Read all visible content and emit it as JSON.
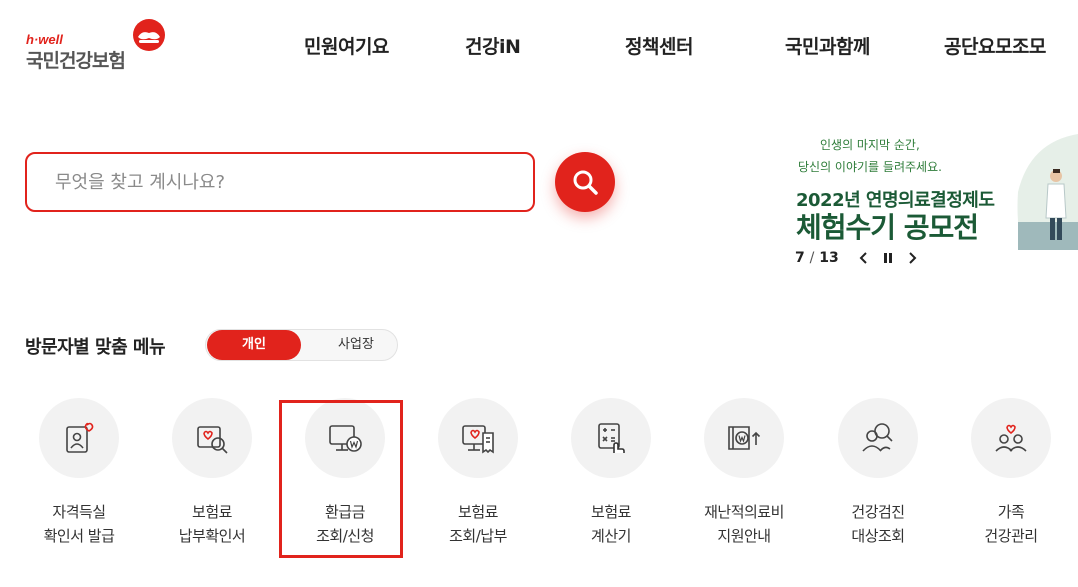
{
  "logo": {
    "tagline": "h·well",
    "name": "국민건강보험"
  },
  "nav": [
    "민원여기요",
    "건강iN",
    "정책센터",
    "국민과함께",
    "공단요모조모"
  ],
  "search": {
    "placeholder": "무엇을 찾고 계시나요?",
    "button_icon": "search-icon"
  },
  "banner": {
    "line1": "인생의 마지막 순간,",
    "line2": "당신의 이야기를 들려주세요.",
    "title1": "2022년 연명의료결정제도",
    "title2": "체험수기 공모전",
    "current": "7",
    "separator": "/",
    "total": "13"
  },
  "custom_menu": {
    "title": "방문자별 맞춤 메뉴",
    "toggle": [
      "개인",
      "사업장"
    ],
    "active": "개인",
    "items": [
      {
        "line1": "자격득실",
        "line2": "확인서 발급",
        "icon": "certificate-person-icon"
      },
      {
        "line1": "보험료",
        "line2": "납부확인서",
        "icon": "document-search-icon"
      },
      {
        "line1": "환급금",
        "line2": "조회/신청",
        "icon": "monitor-won-icon"
      },
      {
        "line1": "보험료",
        "line2": "조회/납부",
        "icon": "monitor-receipt-icon"
      },
      {
        "line1": "보험료",
        "line2": "계산기",
        "icon": "calculator-icon"
      },
      {
        "line1": "재난적의료비",
        "line2": "지원안내",
        "icon": "won-support-icon"
      },
      {
        "line1": "건강검진",
        "line2": "대상조회",
        "icon": "people-search-icon"
      },
      {
        "line1": "가족",
        "line2": "건강관리",
        "icon": "family-heart-icon"
      }
    ]
  },
  "colors": {
    "brand": "#e1231c",
    "banner_green": "#1b5a36"
  }
}
